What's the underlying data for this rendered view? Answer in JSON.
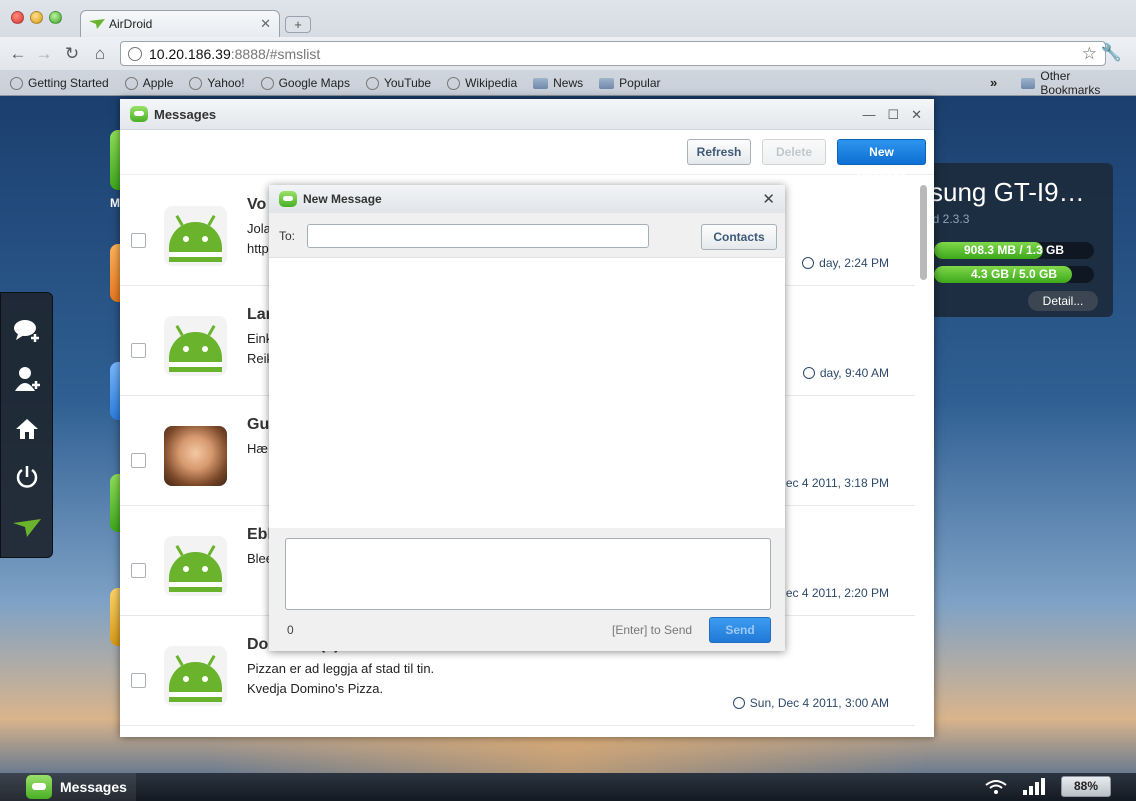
{
  "browser": {
    "tab_title": "AirDroid",
    "url_host": "10.20.186.39",
    "url_rest": ":8888/#smslist",
    "bookmarks": [
      {
        "label": "Getting Started",
        "icon": "globe-icon"
      },
      {
        "label": "Apple",
        "icon": "globe-icon"
      },
      {
        "label": "Yahoo!",
        "icon": "globe-icon"
      },
      {
        "label": "Google Maps",
        "icon": "globe-icon"
      },
      {
        "label": "YouTube",
        "icon": "globe-icon"
      },
      {
        "label": "Wikipedia",
        "icon": "globe-icon"
      },
      {
        "label": "News",
        "icon": "folder-icon"
      },
      {
        "label": "Popular",
        "icon": "folder-icon"
      }
    ],
    "more": "»",
    "other_bookmarks": "Other Bookmarks"
  },
  "device": {
    "name": "sung GT-I9…",
    "os": "id 2.3.3",
    "bar1": {
      "label": "908.3 MB / 1.3 GB",
      "fraction": 0.68
    },
    "bar2": {
      "label": "4.3 GB / 5.0 GB",
      "fraction": 0.86
    },
    "detail": "Detail..."
  },
  "messages_window": {
    "title": "Messages",
    "buttons": {
      "refresh": "Refresh",
      "delete": "Delete",
      "new_message": "New Message"
    },
    "rows": [
      {
        "name": "Vo",
        "line1": "Jola",
        "line2": "http",
        "date": "day, 2:24 PM",
        "avatar": "android"
      },
      {
        "name": "Lar",
        "line1": "Eink",
        "line2": "Reik",
        "date": "day, 9:40 AM",
        "avatar": "android"
      },
      {
        "name": "Gu",
        "line1": "Hæ",
        "line2": "",
        "date": "ec 4 2011, 3:18 PM",
        "avatar": "photo"
      },
      {
        "name": "Ebl",
        "line1": "Blee",
        "line2": "",
        "date": "ec 4 2011, 2:20 PM",
        "avatar": "android"
      },
      {
        "name": "Dominos (4)",
        "line1": "Pizzan er ad leggja af stad til tin.",
        "line2": "Kvedja Domino's Pizza.",
        "date": "Sun, Dec 4 2011, 3:00 AM",
        "avatar": "android"
      }
    ]
  },
  "dialog": {
    "title": "New Message",
    "to_label": "To:",
    "to_value": "",
    "contacts": "Contacts",
    "compose_value": "",
    "char_count": "0",
    "send_hint": "[Enter] to Send",
    "send": "Send"
  },
  "taskbar": {
    "app_label": "Messages",
    "battery": "88%"
  }
}
